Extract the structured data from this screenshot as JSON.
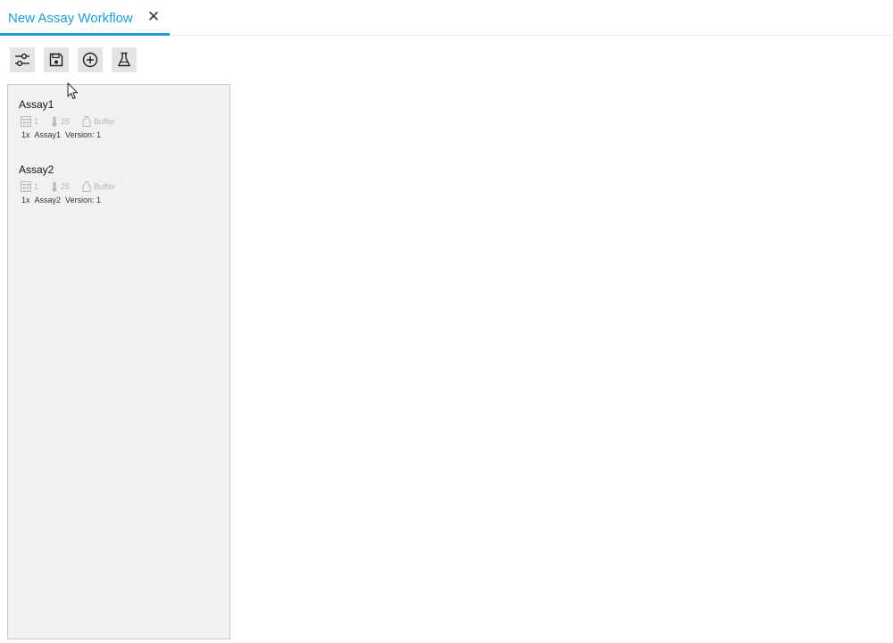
{
  "tab": {
    "title": "New Assay Workflow",
    "close_glyph": "✕",
    "accent_color": "#1f9bd6"
  },
  "toolbar": {
    "buttons": [
      {
        "icon": "sliders-icon",
        "action": "settings"
      },
      {
        "icon": "save-icon",
        "action": "save"
      },
      {
        "icon": "add-circle-icon",
        "action": "add"
      },
      {
        "icon": "flask-icon",
        "action": "assay"
      }
    ]
  },
  "assays": [
    {
      "name": "Assay1",
      "plate": "1",
      "temperature": "25",
      "buffer": "Buffer",
      "count": "1x",
      "label": "Assay1",
      "version": "Version: 1"
    },
    {
      "name": "Assay2",
      "plate": "1",
      "temperature": "25",
      "buffer": "Buffer",
      "count": "1x",
      "label": "Assay2",
      "version": "Version: 1"
    }
  ]
}
